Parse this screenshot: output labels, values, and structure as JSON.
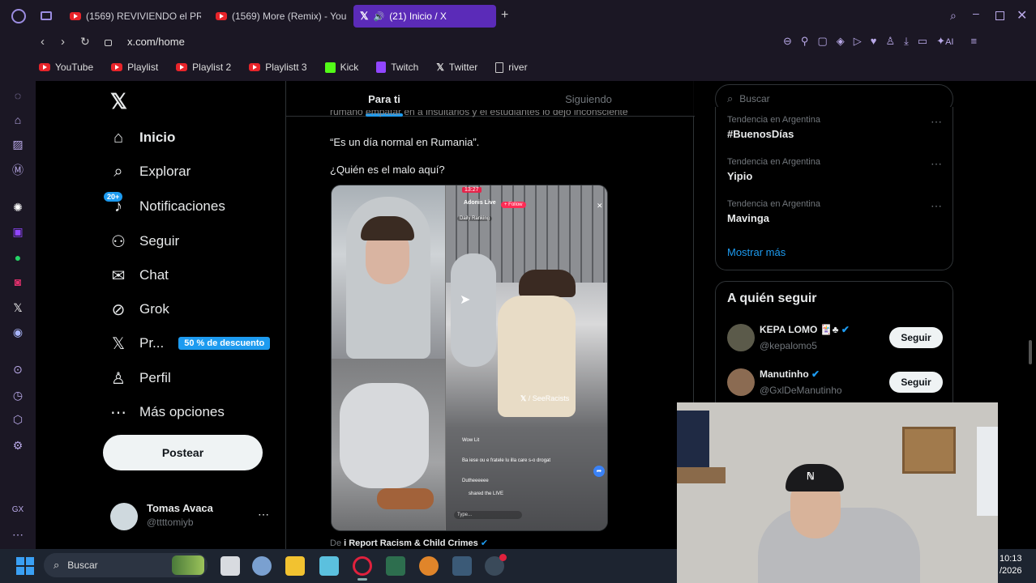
{
  "browser": {
    "tabs": [
      {
        "label": "(1569) REVIVIENDO el PRI",
        "icon": "youtube-icon"
      },
      {
        "label": "(1569) More (Remix) - You",
        "icon": "youtube-icon"
      },
      {
        "label": "(21) Inicio / X",
        "icon": "x-icon",
        "active": true
      }
    ],
    "url": "x.com/home",
    "ai_label": "AI",
    "bookmarks": [
      {
        "label": "YouTube",
        "icon": "youtube-icon"
      },
      {
        "label": "Playlist",
        "icon": "youtube-icon"
      },
      {
        "label": "Playlist 2",
        "icon": "youtube-icon"
      },
      {
        "label": "Playlistt 3",
        "icon": "youtube-icon"
      },
      {
        "label": "Kick",
        "icon": "kick-icon"
      },
      {
        "label": "Twitch",
        "icon": "twitch-icon"
      },
      {
        "label": "Twitter",
        "icon": "x-icon"
      },
      {
        "label": "river",
        "icon": "file-icon"
      }
    ],
    "sidebar_bottom": "GX"
  },
  "nav": {
    "items": [
      {
        "label": "Inicio",
        "icon": "home-icon"
      },
      {
        "label": "Explorar",
        "icon": "search-icon"
      },
      {
        "label": "Notificaciones",
        "icon": "bell-icon",
        "badge": "20+"
      },
      {
        "label": "Seguir",
        "icon": "add-person-icon"
      },
      {
        "label": "Chat",
        "icon": "mail-icon"
      },
      {
        "label": "Grok",
        "icon": "grok-icon"
      },
      {
        "label": "Pr...",
        "icon": "x-premium-icon",
        "promo": "50 % de descuento"
      },
      {
        "label": "Perfil",
        "icon": "person-icon"
      },
      {
        "label": "Más opciones",
        "icon": "more-circle-icon"
      }
    ],
    "post_button": "Postear",
    "account": {
      "name": "Tomas Avaca",
      "handle": "@ttttomiyb"
    }
  },
  "feed": {
    "tabs": [
      "Para ti",
      "Siguiendo"
    ],
    "clipped_text": "rumano empatar en a insultarlos y el estudiantes lo dejó inconsciente",
    "quote": "“Es un día normal en Rumania”.",
    "question": "¿Quién es el malo aquí?",
    "attribution_prefix": "De",
    "attribution_name": "i Report Racism & Child Crimes",
    "video": {
      "time": "13:27",
      "streamer": "Adonis Live",
      "follow": "+ Follow",
      "ranking": "Daily Ranking",
      "watermark": "/ SeeRacists",
      "chat": [
        "Wow Lit",
        "Ba iese ou e fratele lu illa care s-o drogat",
        "Dutheeeeee",
        "shared the LIVE"
      ],
      "type_placeholder": "Type..."
    }
  },
  "right": {
    "search_placeholder": "Buscar",
    "trends": [
      {
        "category": "Tendencia en Argentina",
        "name": "#BuenosDías"
      },
      {
        "category": "Tendencia en Argentina",
        "name": "Yipio"
      },
      {
        "category": "Tendencia en Argentina",
        "name": "Mavinga"
      }
    ],
    "show_more": "Mostrar más",
    "who_to_follow_title": "A quién seguir",
    "suggestions": [
      {
        "name": "KEPA LOMO",
        "handle": "@kepalomo5",
        "button": "Seguir"
      },
      {
        "name": "Manutinho",
        "handle": "@GxlDeManutinho",
        "button": "Seguir"
      }
    ]
  },
  "taskbar": {
    "search_placeholder": "Buscar",
    "time": "10:13",
    "date": "/2026"
  },
  "colors": {
    "accent_x_blue": "#1d9bf0",
    "opera_purple": "#5b2bb8",
    "youtube_red": "#e8242a"
  }
}
